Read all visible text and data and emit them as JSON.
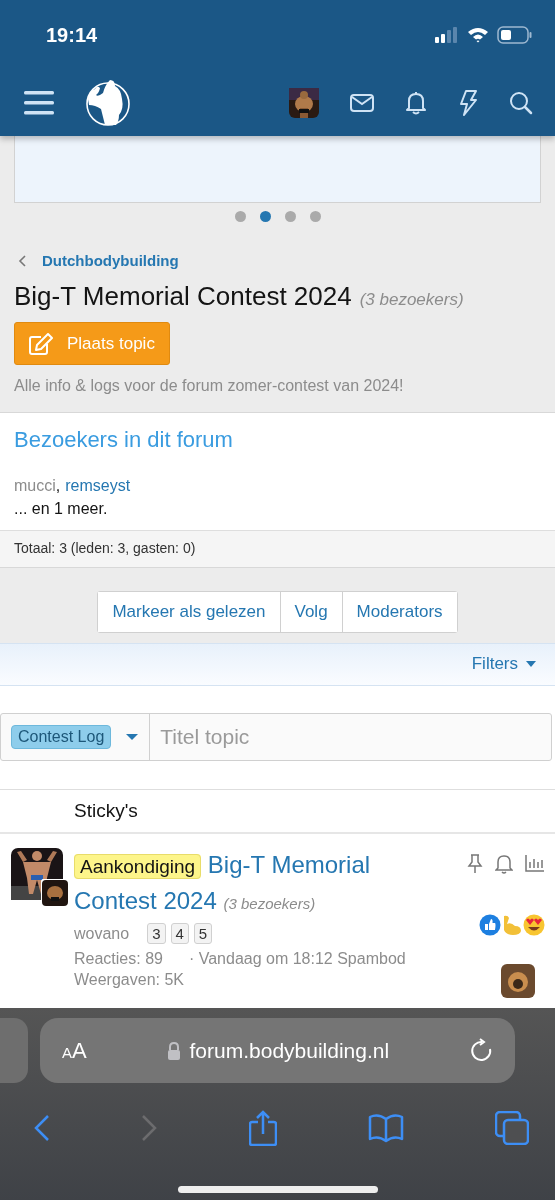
{
  "status_bar": {
    "time": "19:14"
  },
  "carousel": {
    "dots": [
      {
        "selected": false
      },
      {
        "selected": true
      },
      {
        "selected": false
      },
      {
        "selected": false
      }
    ]
  },
  "breadcrumb": "Dutchbodybuilding",
  "forum": {
    "title": "Big-T Memorial Contest 2024",
    "visitors": "(3 bezoekers)",
    "post_button": "Plaats topic",
    "description": "Alle info & logs voor de forum zomer-contest van 2024!"
  },
  "visitors_panel": {
    "title": "Bezoekers in dit forum",
    "users": [
      {
        "name": "mucci",
        "kind": "plain"
      },
      {
        "name": "remseyst",
        "kind": "link"
      }
    ],
    "separator": ",",
    "more": "... en 1 meer.",
    "total": "Totaal: 3 (leden: 3, gasten: 0)"
  },
  "actions": [
    "Markeer als gelezen",
    "Volg",
    "Moderators"
  ],
  "filters": "Filters",
  "new_topic": {
    "prefix": "Contest Log",
    "placeholder": "Titel topic"
  },
  "section": "Sticky's",
  "threads": [
    {
      "prefix": "Aankondiging",
      "title": "Big-T Memorial Contest 2024",
      "visitors": "(3 bezoekers)",
      "author": "wovano",
      "pages": [
        "3",
        "4",
        "5"
      ],
      "replies": "Reacties: 89",
      "last_post": "· Vandaag om 18:12 Spambod",
      "views": "Weergaven: 5K"
    }
  ],
  "browser": {
    "text_size_button": "AA",
    "url": "forum.bodybuilding.nl"
  }
}
